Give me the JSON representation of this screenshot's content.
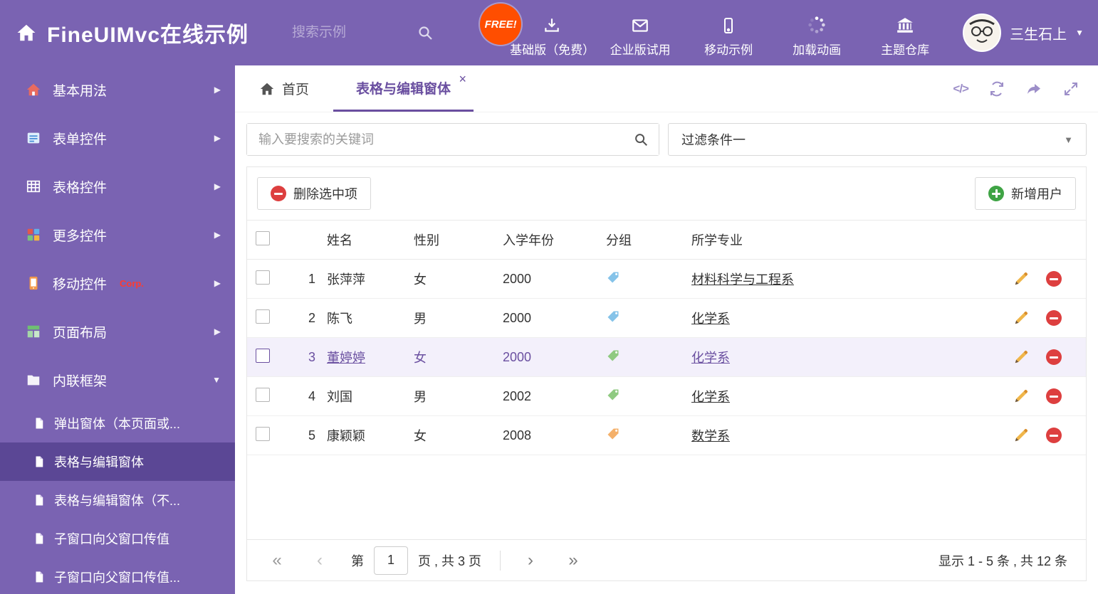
{
  "icons": {
    "chevron_right": "▶",
    "chevron_down": "▼",
    "caret_down": "▼",
    "close": "×",
    "code": "</>",
    "first_page": "«",
    "prev_page": "‹",
    "next_page": "›",
    "last_page": "»"
  },
  "colors": {
    "purple": "#7a63b2",
    "purple_dark": "#5b4795",
    "accent_text": "#6a4fa0",
    "free_badge": "#ff4e00",
    "delete_red": "#dd3f3f",
    "add_green": "#3fa445",
    "edit_yellow": "#f0b64a"
  },
  "header": {
    "title": "FineUIMvc在线示例",
    "search_placeholder": "搜索示例",
    "free_badge": "FREE!",
    "nav_items": [
      {
        "label": "基础版（免费）",
        "icon": "download-icon"
      },
      {
        "label": "企业版试用",
        "icon": "envelope-icon"
      },
      {
        "label": "移动示例",
        "icon": "mobile-icon"
      },
      {
        "label": "加载动画",
        "icon": "spinner-icon"
      },
      {
        "label": "主题仓库",
        "icon": "bank-icon"
      }
    ],
    "username": "三生石上"
  },
  "sidebar": {
    "items": [
      {
        "label": "基本用法",
        "icon": "home-icon"
      },
      {
        "label": "表单控件",
        "icon": "form-icon"
      },
      {
        "label": "表格控件",
        "icon": "table-icon"
      },
      {
        "label": "更多控件",
        "icon": "widgets-icon"
      },
      {
        "label": "移动控件",
        "badge": "Corp.",
        "icon": "mobile-controls-icon"
      },
      {
        "label": "页面布局",
        "icon": "layout-icon"
      },
      {
        "label": "内联框架",
        "icon": "iframe-icon",
        "expanded": true
      }
    ],
    "subitems": [
      {
        "label": "弹出窗体（本页面或..."
      },
      {
        "label": "表格与编辑窗体",
        "active": true
      },
      {
        "label": "表格与编辑窗体（不..."
      },
      {
        "label": "子窗口向父窗口传值"
      },
      {
        "label": "子窗口向父窗口传值..."
      }
    ]
  },
  "tabs": {
    "home_label": "首页",
    "active_label": "表格与编辑窗体"
  },
  "filterbar": {
    "search_placeholder": "输入要搜索的关键词",
    "filter_value": "过滤条件一"
  },
  "toolbar": {
    "delete_label": "删除选中项",
    "add_label": "新增用户"
  },
  "table": {
    "columns": {
      "name": "姓名",
      "gender": "性别",
      "year": "入学年份",
      "group": "分组",
      "major": "所学专业"
    },
    "rows": [
      {
        "num": "1",
        "name": "张萍萍",
        "gender": "女",
        "year": "2000",
        "tag_color": "#85c3e9",
        "major": "材料科学与工程系",
        "selected": false
      },
      {
        "num": "2",
        "name": "陈飞",
        "gender": "男",
        "year": "2000",
        "tag_color": "#85c3e9",
        "major": "化学系",
        "selected": false
      },
      {
        "num": "3",
        "name": "董婷婷",
        "gender": "女",
        "year": "2000",
        "tag_color": "#8fca81",
        "major": "化学系",
        "selected": true
      },
      {
        "num": "4",
        "name": "刘国",
        "gender": "男",
        "year": "2002",
        "tag_color": "#8fca81",
        "major": "化学系",
        "selected": false
      },
      {
        "num": "5",
        "name": "康颖颖",
        "gender": "女",
        "year": "2008",
        "tag_color": "#f4b06a",
        "major": "数学系",
        "selected": false
      }
    ]
  },
  "pagination": {
    "page_prefix": "第",
    "current_page": "1",
    "page_suffix": "页 , 共 3 页",
    "summary": "显示 1 - 5 条 , 共 12 条"
  }
}
